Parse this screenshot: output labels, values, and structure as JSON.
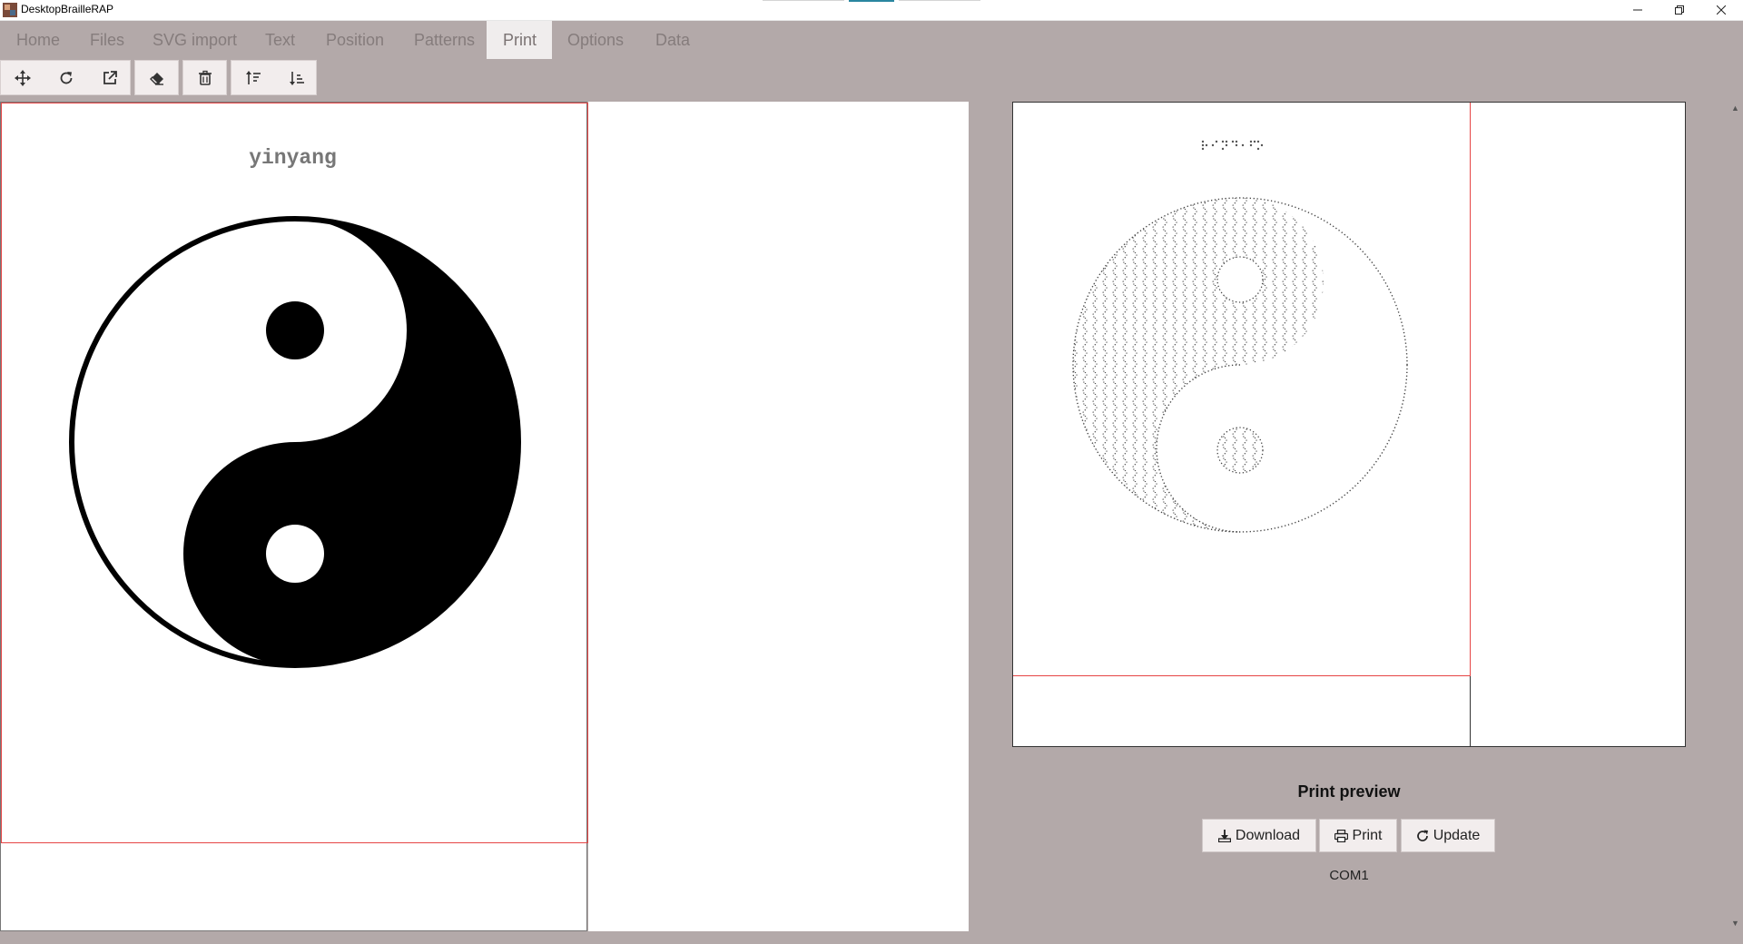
{
  "window": {
    "title": "DesktopBrailleRAP"
  },
  "menu": {
    "tabs": [
      {
        "label": "Home"
      },
      {
        "label": "Files"
      },
      {
        "label": "SVG import"
      },
      {
        "label": "Text"
      },
      {
        "label": "Position"
      },
      {
        "label": "Patterns"
      },
      {
        "label": "Print"
      },
      {
        "label": "Options"
      },
      {
        "label": "Data"
      }
    ],
    "active": "Print"
  },
  "toolbar": {
    "icons": [
      "move-icon",
      "rotate-icon",
      "external-link-icon",
      "eraser-icon",
      "trash-icon",
      "sort-up-icon",
      "sort-down-icon"
    ]
  },
  "canvas": {
    "text_label": "yinyang"
  },
  "preview": {
    "title": "Print preview",
    "buttons": {
      "download": "Download",
      "print": "Print",
      "update": "Update"
    },
    "port": "COM1"
  },
  "colors": {
    "background": "#b3a9a9",
    "page_border": "#e64545",
    "menu_text": "#857c7c"
  }
}
